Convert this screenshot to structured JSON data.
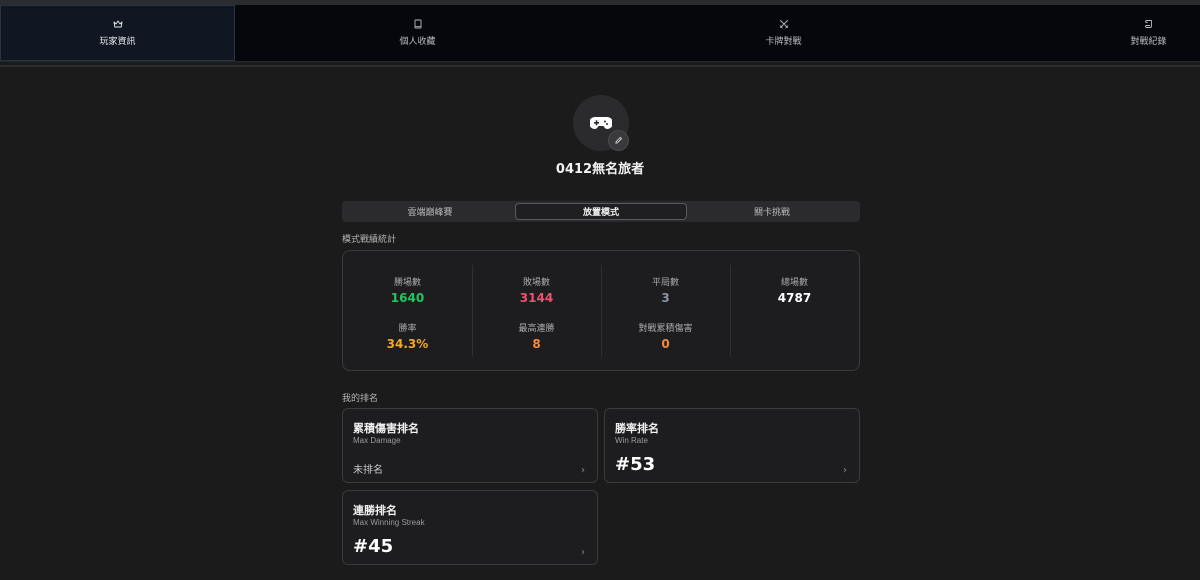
{
  "nav": {
    "items": [
      {
        "label": "玩家資訊",
        "icon": "crown-icon"
      },
      {
        "label": "個人收藏",
        "icon": "book-icon"
      },
      {
        "label": "卡牌對戰",
        "icon": "swords-icon"
      },
      {
        "label": "對戰紀錄",
        "icon": "scroll-icon"
      }
    ],
    "active_index": 0
  },
  "profile": {
    "avatar_icon": "gamepad-icon",
    "edit_icon": "pencil-icon",
    "name": "0412無名旅者"
  },
  "mode_tabs": {
    "items": [
      "雲端巔峰賽",
      "放置模式",
      "關卡挑戰"
    ],
    "active_index": 1
  },
  "stats": {
    "section_title": "模式戰績統計",
    "items": [
      {
        "label": "勝場數",
        "value": "1640",
        "color": "#22c55e"
      },
      {
        "label": "敗場數",
        "value": "3144",
        "color": "#f0506e"
      },
      {
        "label": "平局數",
        "value": "3",
        "color": "#8a93a3"
      },
      {
        "label": "總場數",
        "value": "4787",
        "color": "#ffffff"
      },
      {
        "label": "勝率",
        "value": "34.3%",
        "color": "#f5a524"
      },
      {
        "label": "最高連勝",
        "value": "8",
        "color": "#f58a3c"
      },
      {
        "label": "對戰累積傷害",
        "value": "0",
        "color": "#f58a3c"
      }
    ]
  },
  "rankings": {
    "section_title": "我的排名",
    "cards": [
      {
        "title": "累積傷害排名",
        "subtitle": "Max Damage",
        "value": "未排名",
        "chevron": "›"
      },
      {
        "title": "勝率排名",
        "subtitle": "Win Rate",
        "value": "#53",
        "chevron": "›"
      },
      {
        "title": "連勝排名",
        "subtitle": "Max Winning Streak",
        "value": "#45",
        "chevron": "›"
      }
    ]
  }
}
